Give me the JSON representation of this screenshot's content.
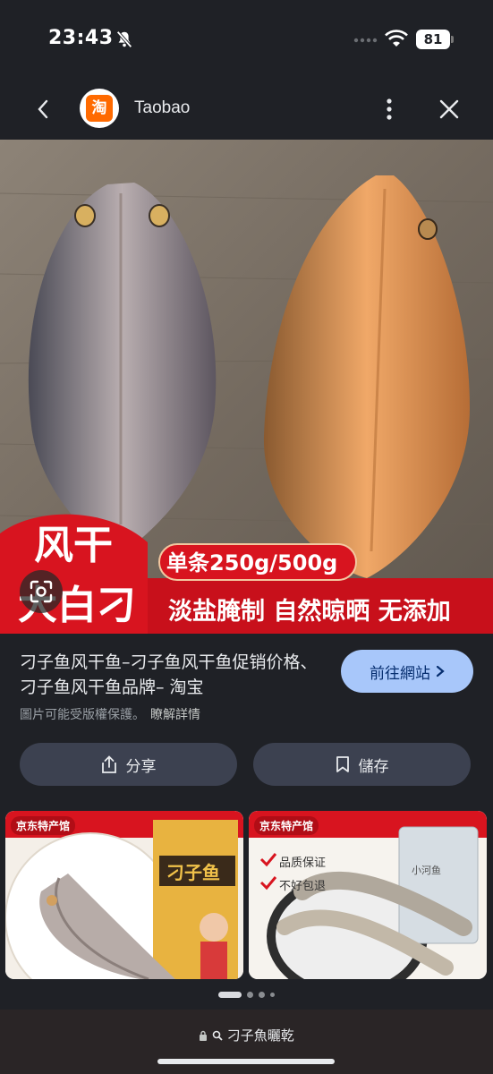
{
  "status": {
    "time": "23:43",
    "battery": "81"
  },
  "header": {
    "site_name": "Taobao",
    "logo_char": "淘"
  },
  "image": {
    "label_big_1": "风干",
    "label_big_2": "大白刁",
    "label_weight": "单条250g/500g",
    "label_features": "淡盐腌制 自然晾晒 无添加"
  },
  "info": {
    "title": "刁子鱼风干鱼–刁子鱼风干鱼促销价格、刁子鱼风干鱼品牌– 淘宝",
    "visit_label": "前往網站",
    "copyright": "圖片可能受版權保護。",
    "learn_more": "瞭解詳情",
    "share_label": "分享",
    "save_label": "儲存"
  },
  "related": [
    {
      "tag": "京东特产馆",
      "product_text": "刁子鱼"
    },
    {
      "tag": "京东特产馆",
      "badge_1": "品质保证",
      "badge_2": "不好包退",
      "product_text": "小河鱼"
    }
  ],
  "address_bar": {
    "url": "刁子魚曬乾"
  },
  "colors": {
    "accent": "#a8c7fa",
    "background": "#1f2126",
    "taobao": "#ff6a00",
    "banner_red": "#d8141f"
  }
}
